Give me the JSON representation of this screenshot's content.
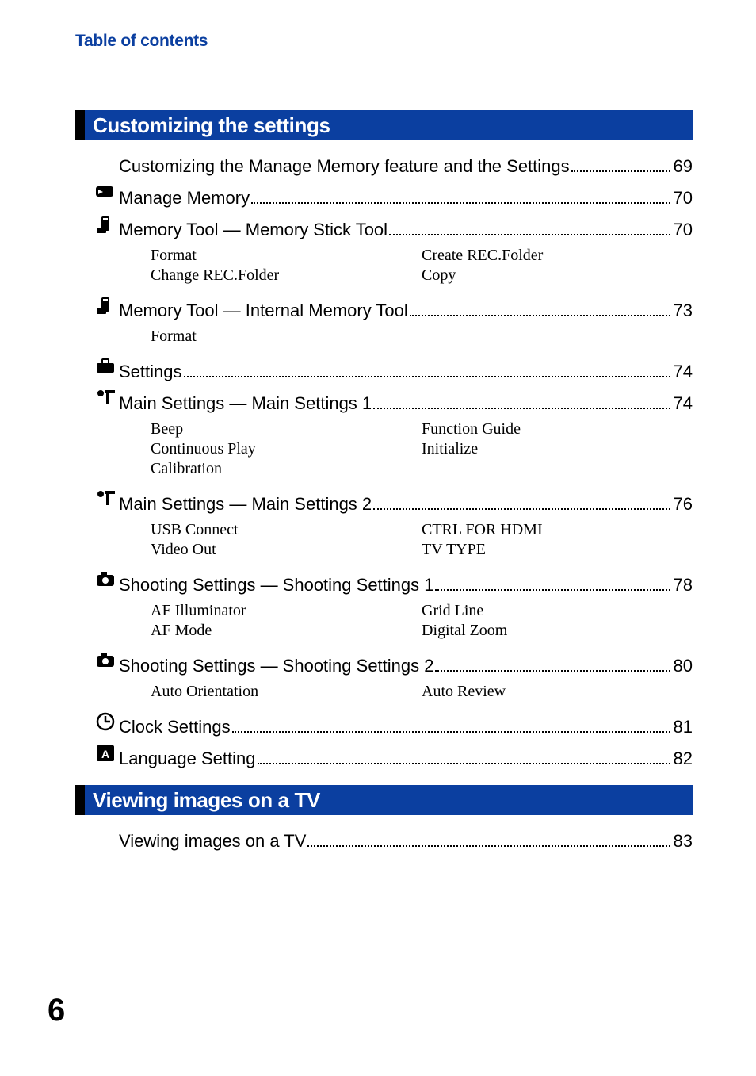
{
  "header": "Table of contents",
  "page_number": "6",
  "sections": [
    {
      "title": "Customizing the settings",
      "entries": [
        {
          "icon": "none",
          "title": "Customizing the Manage Memory feature and the Settings",
          "page": "69"
        },
        {
          "icon": "manage",
          "title": "Manage Memory",
          "page": "70"
        },
        {
          "icon": "memory-tool",
          "title": "Memory Tool — Memory Stick Tool",
          "page": "70",
          "subs": {
            "left": [
              "Format",
              "Change REC.Folder"
            ],
            "right": [
              "Create REC.Folder",
              "Copy"
            ]
          }
        },
        {
          "icon": "memory-tool",
          "title": "Memory Tool — Internal Memory Tool",
          "page": "73",
          "subs": {
            "left": [
              "Format"
            ],
            "right": []
          }
        },
        {
          "icon": "settings",
          "title": "Settings",
          "page": "74"
        },
        {
          "icon": "main-settings",
          "title": "Main Settings — Main Settings 1",
          "page": "74",
          "subs": {
            "left": [
              "Beep",
              "Continuous Play",
              "Calibration"
            ],
            "right": [
              "Function Guide",
              "Initialize"
            ]
          }
        },
        {
          "icon": "main-settings",
          "title": "Main Settings — Main Settings 2",
          "page": "76",
          "subs": {
            "left": [
              "USB Connect",
              "Video Out"
            ],
            "right": [
              "CTRL FOR HDMI",
              "TV TYPE"
            ]
          }
        },
        {
          "icon": "camera",
          "title": "Shooting Settings — Shooting Settings 1",
          "page": "78",
          "subs": {
            "left": [
              "AF Illuminator",
              "AF Mode"
            ],
            "right": [
              "Grid Line",
              "Digital Zoom"
            ]
          }
        },
        {
          "icon": "camera",
          "title": "Shooting Settings — Shooting Settings 2",
          "page": "80",
          "subs": {
            "left": [
              "Auto Orientation"
            ],
            "right": [
              "Auto Review"
            ]
          }
        },
        {
          "icon": "clock",
          "title": "Clock Settings",
          "page": "81"
        },
        {
          "icon": "language",
          "title": "Language Setting",
          "page": "82"
        }
      ]
    },
    {
      "title": "Viewing images on a TV",
      "entries": [
        {
          "icon": "none",
          "title": "Viewing images on a TV",
          "page": "83"
        }
      ]
    }
  ]
}
